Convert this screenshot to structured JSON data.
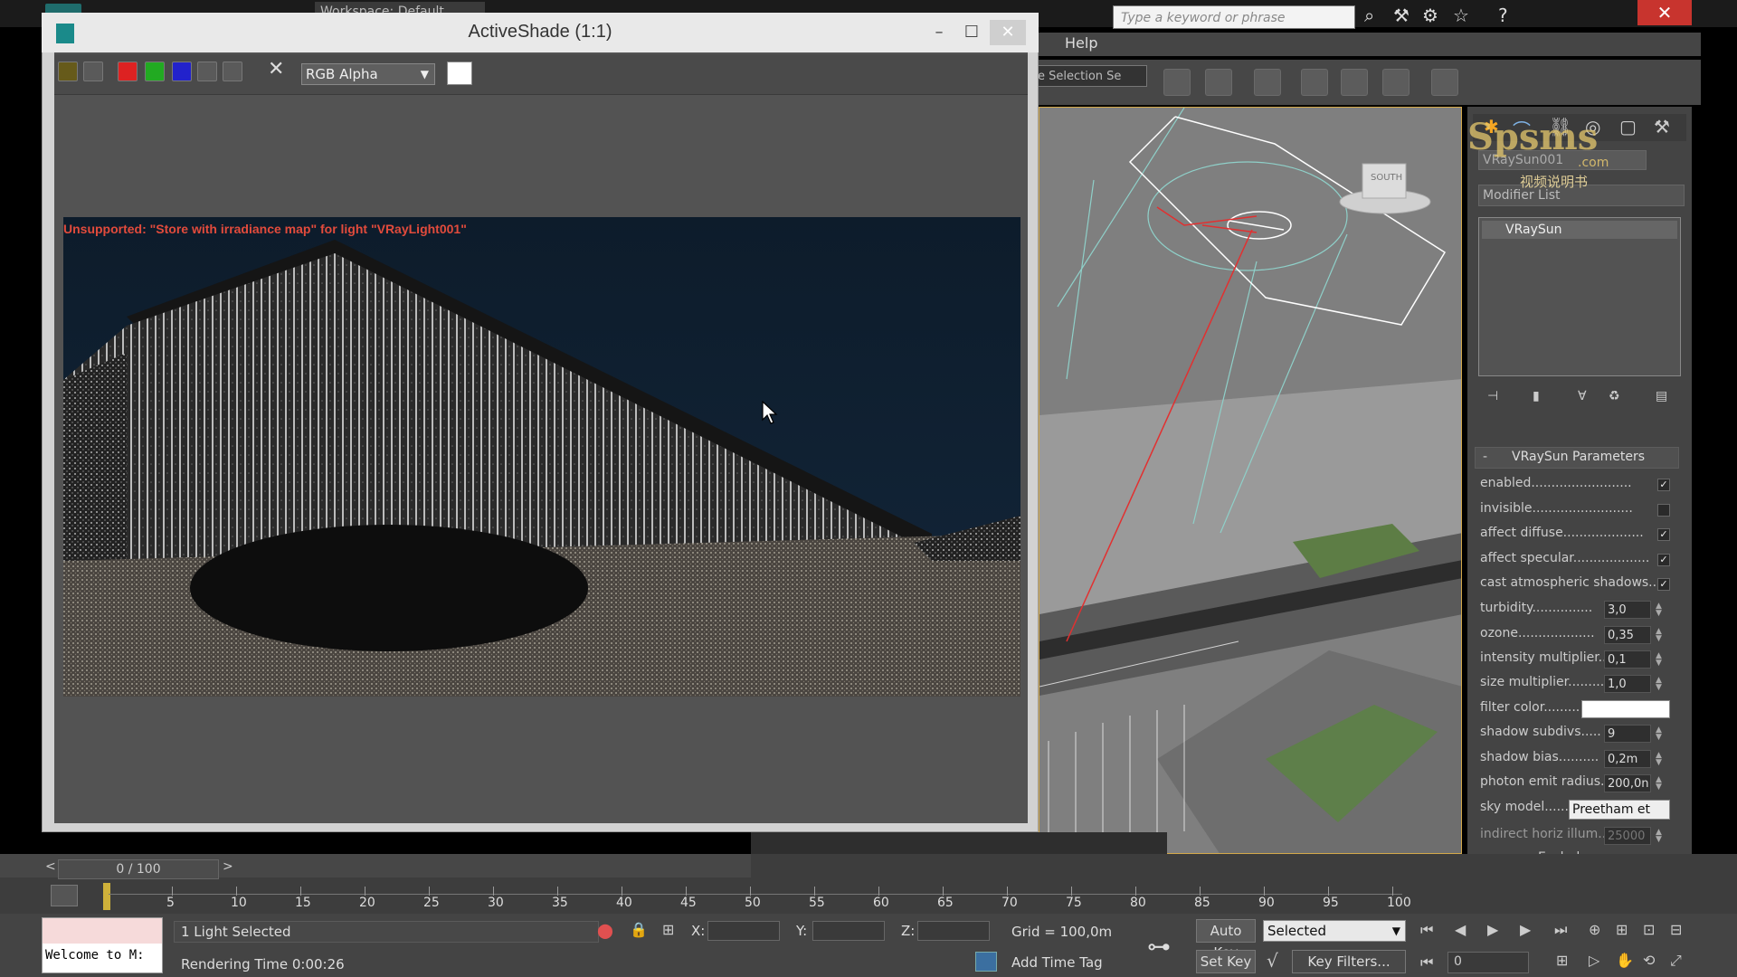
{
  "main_window": {
    "search_placeholder": "Type a keyword or phrase",
    "menu_help": "Help",
    "selection_set": "e Selection Se",
    "close_glyph": "✕",
    "top_workspace": "Workspace: Default"
  },
  "active_shade": {
    "title": "ActiveShade (1:1)",
    "channel": "RGB Alpha",
    "warning": "Unsupported: \"Store with irradiance map\" for light \"VRayLight001\"",
    "minimize": "–",
    "maximize": "☐",
    "close": "✕"
  },
  "command_panel": {
    "object_name": "VRaySun001",
    "modifier_list": "Modifier List",
    "stack_item": "VRaySun",
    "rollout_title": "VRaySun Parameters",
    "rollout_toggle": "-",
    "params": [
      {
        "label": "enabled.........................",
        "checked": true
      },
      {
        "label": "invisible.........................",
        "checked": false
      },
      {
        "label": "affect diffuse....................",
        "checked": true
      },
      {
        "label": "affect specular...................",
        "checked": true
      },
      {
        "label": "cast atmospheric shadows..",
        "checked": true
      }
    ],
    "values": [
      {
        "label": "turbidity...............",
        "value": "3,0"
      },
      {
        "label": "ozone...................",
        "value": "0,35"
      },
      {
        "label": "intensity multiplier..",
        "value": "0,1"
      },
      {
        "label": "size multiplier..........",
        "value": "1,0"
      },
      {
        "label": "filter color.........",
        "value": ""
      },
      {
        "label": "shadow subdivs.....",
        "value": "9"
      },
      {
        "label": "shadow bias..........",
        "value": "0,2m"
      },
      {
        "label": "photon emit radius.",
        "value": "200,0n"
      }
    ],
    "sky_model_label": "sky model......",
    "sky_model_value": "Preetham et",
    "indirect_label": "indirect horiz illum..",
    "indirect_value": "25000",
    "exclude": "Exclude...",
    "filter_color": "#ffffff"
  },
  "viewcube_label": "SOUTH",
  "watermark": {
    "text": "Spsms",
    "domain": ".com",
    "cn": "视频说明书"
  },
  "timeline": {
    "frame": "0 / 100",
    "prev": "<",
    "next": ">",
    "ticks": [
      "5",
      "10",
      "15",
      "20",
      "25",
      "30",
      "35",
      "40",
      "45",
      "50",
      "55",
      "60",
      "65",
      "70",
      "75",
      "80",
      "85",
      "90",
      "95",
      "100"
    ]
  },
  "status": {
    "welcome": "Welcome to M:",
    "selection": "1 Light Selected",
    "rendering_time": "Rendering Time  0:00:26",
    "x_label": "X:",
    "y_label": "Y:",
    "z_label": "Z:",
    "grid": "Grid = 100,0m",
    "add_time_tag": "Add Time Tag",
    "auto_key": "Auto Key",
    "set_key": "Set Key",
    "selected": "Selected",
    "key_filters": "Key Filters...",
    "frame_field": "0"
  }
}
